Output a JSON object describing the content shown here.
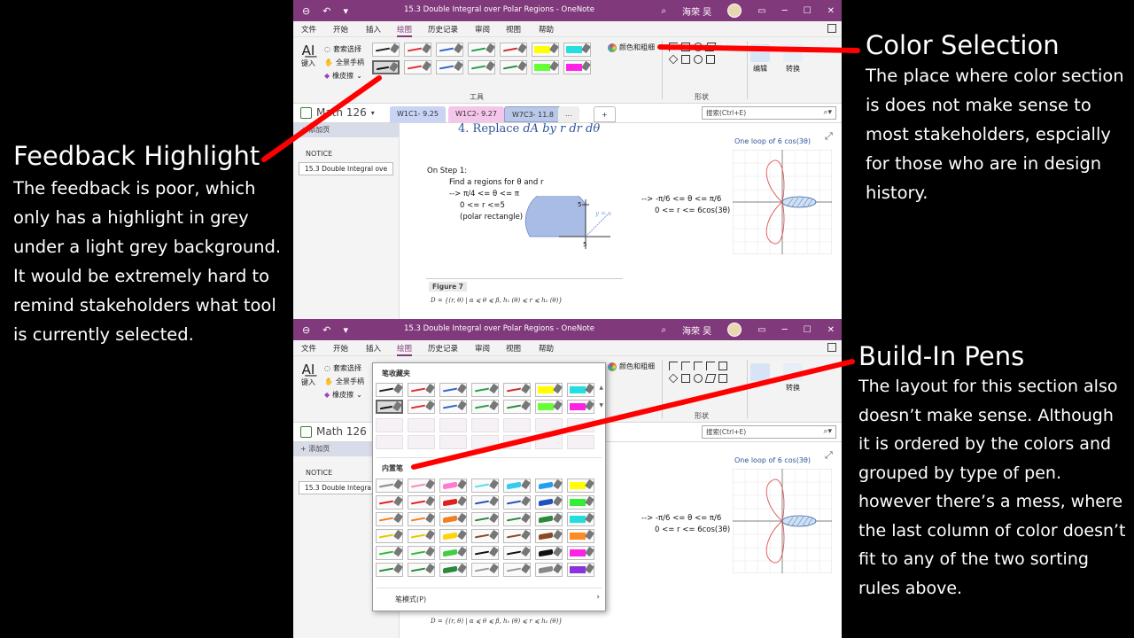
{
  "annotations": {
    "feedback": {
      "title": "Feedback Highlight",
      "body": "The feedback is poor, which only has a highlight in grey under a light grey background. It would be extremely hard to remind stakeholders what tool is currently selected."
    },
    "color": {
      "title": "Color Selection",
      "body": "The place where color section is does not make sense to most stakeholders, espcially for those who are in design history."
    },
    "buildin": {
      "title": "Build-In Pens",
      "lines": [
        "The layout for this section also",
        "doesn’t make sense. Although",
        "it is ordered by the colors and",
        "grouped by type of pen.",
        "however there’s a mess, where",
        "the last column of color doesn’t",
        "fit to any of the two sorting",
        "rules above."
      ]
    }
  },
  "colors": {
    "arrow": "#ff0000",
    "titlebar": "#80397b",
    "tab_w1c1": "#c9d4f5",
    "tab_w1c2": "#f4c6ea",
    "tab_w7c3": "#b9c8e8"
  },
  "app": {
    "window_title": "15.3 Double Integral over Polar Regions  -  OneNote",
    "user_name": "海荣 吴",
    "menu": [
      "文件",
      "开始",
      "插入",
      "绘图",
      "历史记录",
      "审阅",
      "视图",
      "帮助"
    ],
    "active_menu": "绘图",
    "ribbon": {
      "input_label": "键入",
      "tools": [
        "套索选择",
        "全景手柄",
        "橡皮擦"
      ],
      "group_tools_label": "工具",
      "color_button": "颜色和粗细",
      "group_shapes_label": "形状",
      "edit_label": "编辑",
      "convert_label": "转换"
    },
    "notebook": "Math 126",
    "section_tabs": [
      "W1C1- 9.25",
      "W1C2- 9.27",
      "W7C3- 11.8",
      "..."
    ],
    "search_placeholder": "搜索(Ctrl+E)",
    "add_page": "添加页",
    "pages": [
      "NOTICE",
      "15.3 Double Integral ove",
      "15.3 Double Integra"
    ],
    "note": {
      "step_heading_prefix": "4.    Replace ",
      "step_heading_math": "dA by r dr dθ",
      "step_lines": [
        "On Step 1:",
        "Find a regions for θ and r",
        "--> π/4 <= θ <= π",
        "0 <= r <=5",
        "(polar rectangle)"
      ],
      "right_lines": [
        "--> -π/6 <= θ <= π/6",
        "0 <= r <= 6cos(3θ)"
      ],
      "graph_line_label": "y = x",
      "graph_tick": "5",
      "figure_label": "Figure 7",
      "figure_formula": "D = {(r, θ) | α ⩽ θ ⩽ β, h₁ (θ) ⩽ r ⩽ h₂ (θ)}",
      "plot_title": "One loop of 6 cos(3θ)"
    },
    "dropdown": {
      "favorites_heading": "笔收藏夹",
      "builtin_heading": "内置笔",
      "footer": "笔模式(P)"
    }
  },
  "pens": {
    "favorites": [
      {
        "type": "pen",
        "color": "#222222"
      },
      {
        "type": "pen",
        "color": "#e03030"
      },
      {
        "type": "pen",
        "color": "#2f66c9"
      },
      {
        "type": "pen",
        "color": "#23a04a"
      },
      {
        "type": "pen",
        "color": "#d02a2a"
      },
      {
        "type": "hl",
        "color": "#ffff00"
      },
      {
        "type": "hl",
        "color": "#22e0e0"
      },
      {
        "type": "pen",
        "color": "#111111",
        "selected": true
      },
      {
        "type": "pen",
        "color": "#e03030"
      },
      {
        "type": "pen",
        "color": "#2f66c9"
      },
      {
        "type": "pen",
        "color": "#23a04a"
      },
      {
        "type": "pen",
        "color": "#2a8a3a"
      },
      {
        "type": "hl",
        "color": "#66ff33"
      },
      {
        "type": "hl",
        "color": "#ff22e6"
      }
    ],
    "builtin": [
      {
        "type": "pen",
        "color": "#888888"
      },
      {
        "type": "pen",
        "color": "#f08ac0"
      },
      {
        "type": "thick",
        "color": "#ff7ad0"
      },
      {
        "type": "pen",
        "color": "#55ddee"
      },
      {
        "type": "thick",
        "color": "#33ccee"
      },
      {
        "type": "thick",
        "color": "#22a0ee"
      },
      {
        "type": "hl",
        "color": "#ffff00"
      },
      {
        "type": "pen",
        "color": "#e02020"
      },
      {
        "type": "pen",
        "color": "#e02020"
      },
      {
        "type": "thick",
        "color": "#e02020"
      },
      {
        "type": "pen",
        "color": "#1f4fc0"
      },
      {
        "type": "pen",
        "color": "#1f4fc0"
      },
      {
        "type": "thick",
        "color": "#1f4fc0"
      },
      {
        "type": "hl",
        "color": "#33ee33"
      },
      {
        "type": "pen",
        "color": "#f08020"
      },
      {
        "type": "pen",
        "color": "#f08020"
      },
      {
        "type": "thick",
        "color": "#f08020"
      },
      {
        "type": "pen",
        "color": "#2a8a3a"
      },
      {
        "type": "pen",
        "color": "#2a8a3a"
      },
      {
        "type": "thick",
        "color": "#2a8a3a"
      },
      {
        "type": "hl",
        "color": "#22dddd"
      },
      {
        "type": "pen",
        "color": "#e8c800"
      },
      {
        "type": "pen",
        "color": "#e8c800"
      },
      {
        "type": "thick",
        "color": "#ffd400"
      },
      {
        "type": "pen",
        "color": "#8a4a20"
      },
      {
        "type": "pen",
        "color": "#8a4a20"
      },
      {
        "type": "thick",
        "color": "#8a4a20"
      },
      {
        "type": "hl",
        "color": "#ff8a20"
      },
      {
        "type": "pen",
        "color": "#33bb33"
      },
      {
        "type": "pen",
        "color": "#33bb33"
      },
      {
        "type": "thick",
        "color": "#44cc44"
      },
      {
        "type": "pen",
        "color": "#111111"
      },
      {
        "type": "pen",
        "color": "#111111"
      },
      {
        "type": "thick",
        "color": "#111111"
      },
      {
        "type": "hl",
        "color": "#ff22e6"
      },
      {
        "type": "pen",
        "color": "#2a8a3a"
      },
      {
        "type": "pen",
        "color": "#2a8a3a"
      },
      {
        "type": "thick",
        "color": "#2a8a3a"
      },
      {
        "type": "pen",
        "color": "#999999"
      },
      {
        "type": "pen",
        "color": "#999999"
      },
      {
        "type": "thick",
        "color": "#888888"
      },
      {
        "type": "hl",
        "color": "#8833dd"
      }
    ]
  }
}
